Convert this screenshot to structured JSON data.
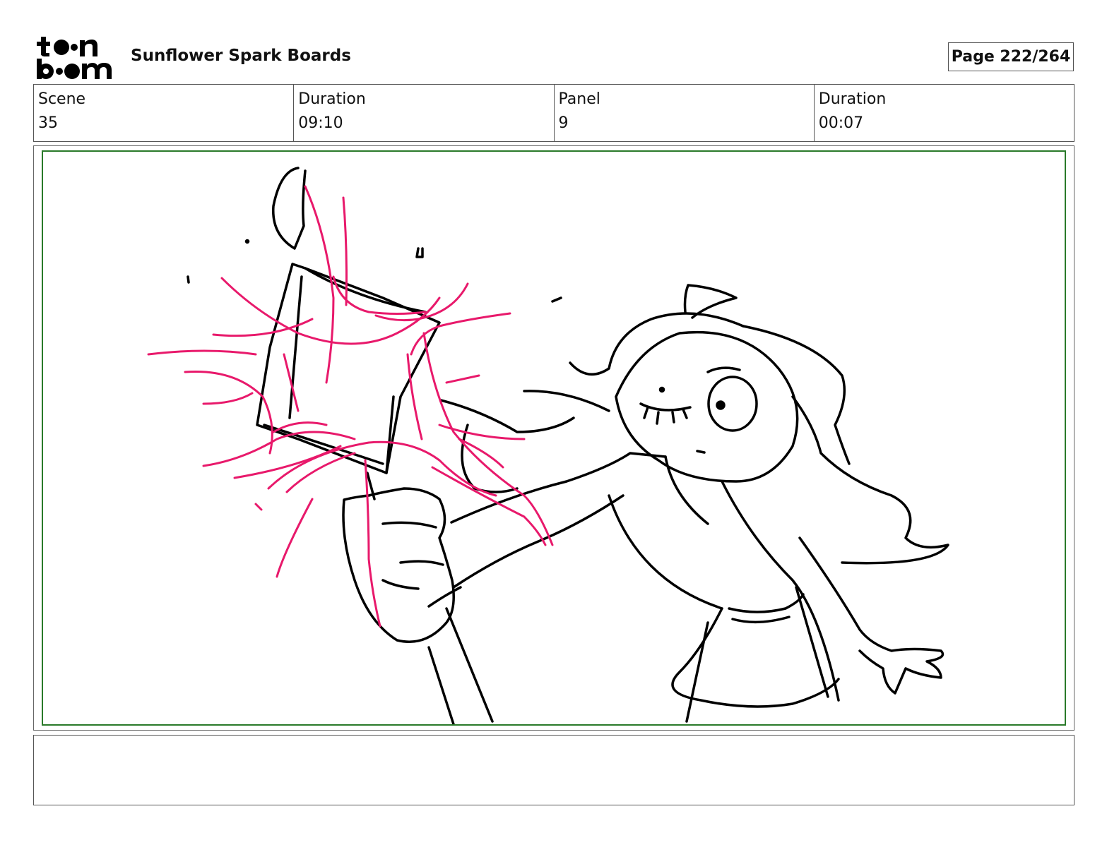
{
  "header": {
    "logo": {
      "line1": "toon",
      "line2": "boom",
      "icon": "toon-boom-logo"
    },
    "title": "Sunflower Spark Boards",
    "page_label": "Page 222/264"
  },
  "info": {
    "scene_label": "Scene",
    "scene_value": "35",
    "scene_duration_label": "Duration",
    "scene_duration_value": "09:10",
    "panel_label": "Panel",
    "panel_value": "9",
    "panel_duration_label": "Duration",
    "panel_duration_value": "00:07"
  },
  "panel": {
    "border_color": "#2a7a2a",
    "sketch_color": "#000000",
    "effect_color": "#e8196b"
  },
  "notes": {
    "text": ""
  }
}
